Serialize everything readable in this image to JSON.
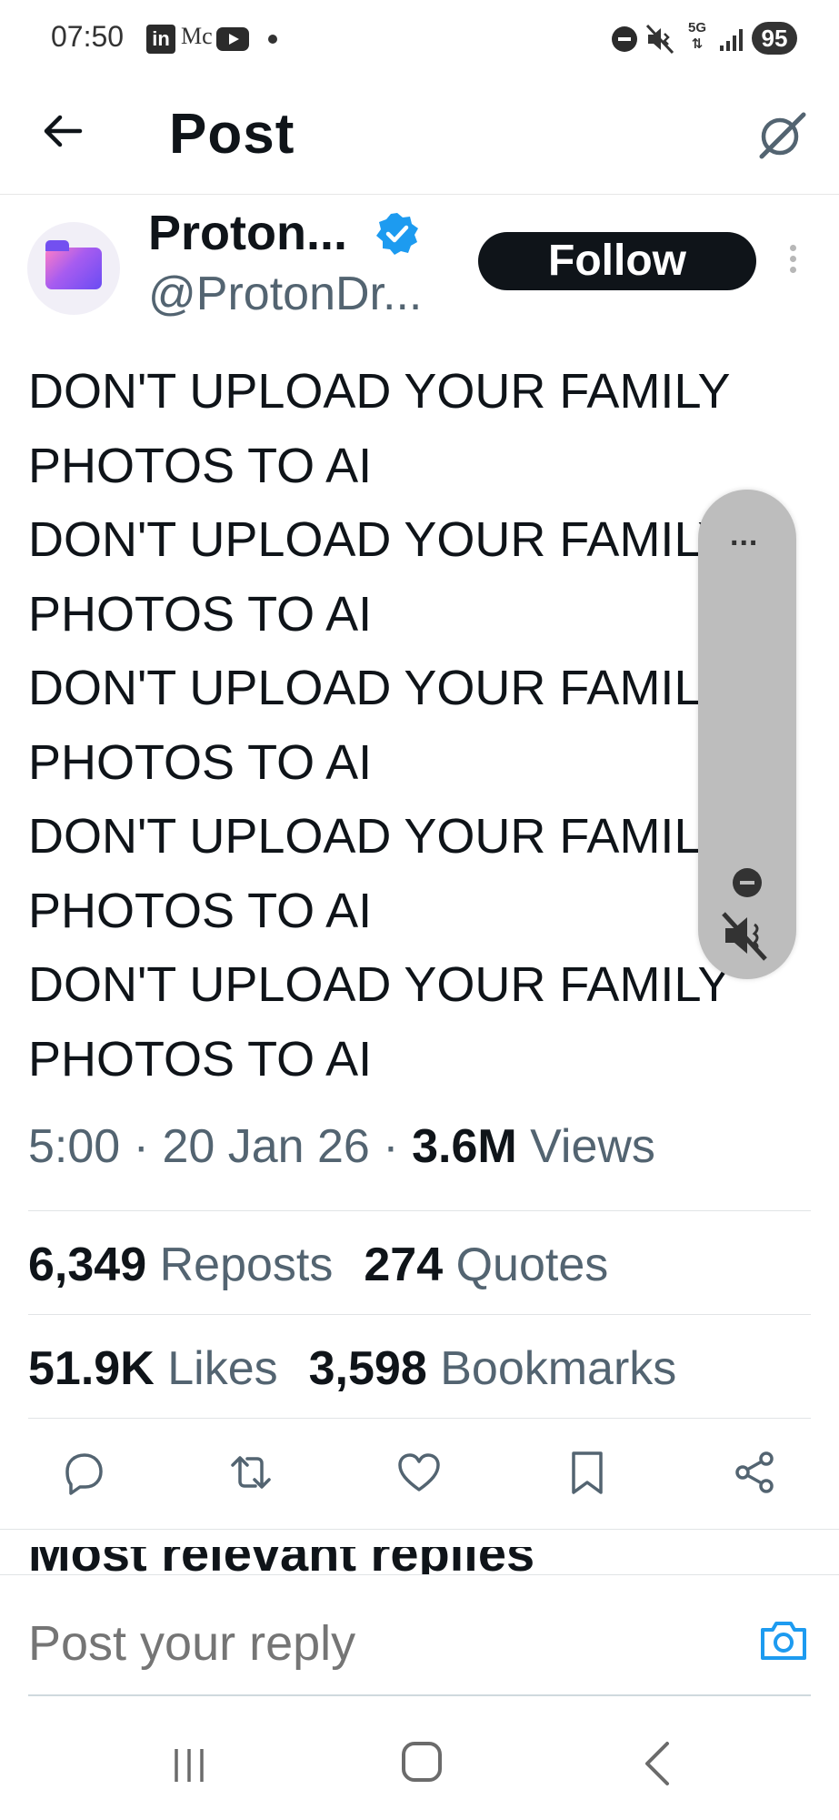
{
  "status_bar": {
    "time": "07:50",
    "linkedin_label": "in",
    "m_label": "Mc",
    "five_g": "5G",
    "battery": "95"
  },
  "header": {
    "title": "Post",
    "back_icon": "arrow-left-icon",
    "grok_icon": "grok-icon"
  },
  "post": {
    "author_name": "Proton...",
    "author_handle": "@ProtonDr...",
    "verified": true,
    "follow_label": "Follow",
    "text_lines": [
      "DON'T UPLOAD YOUR FAMILY",
      "PHOTOS TO AI",
      "DON'T UPLOAD YOUR FAMILY",
      "PHOTOS TO AI",
      "DON'T UPLOAD YOUR FAMILY",
      "PHOTOS TO AI",
      "DON'T UPLOAD YOUR FAMILY",
      "PHOTOS TO AI",
      "DON'T UPLOAD YOUR FAMILY",
      "PHOTOS TO AI"
    ],
    "time": "5:00",
    "date": "20 Jan 26",
    "views_count": "3.6M",
    "views_label": "Views",
    "reposts_count": "6,349",
    "reposts_label": "Reposts",
    "quotes_count": "274",
    "quotes_label": "Quotes",
    "likes_count": "51.9K",
    "likes_label": "Likes",
    "bookmarks_count": "3,598",
    "bookmarks_label": "Bookmarks"
  },
  "actions": [
    "reply-icon",
    "repost-icon",
    "like-icon",
    "bookmark-icon",
    "share-icon"
  ],
  "next_section_partial": "Most relevant replies",
  "reply": {
    "placeholder": "Post your reply"
  },
  "volume_panel": {
    "more_label": "..."
  },
  "colors": {
    "text_primary": "#0f1419",
    "text_secondary": "#536471",
    "verified_blue": "#1d9bf0",
    "follow_bg": "#0f1419",
    "panel_gray": "#bdbdbd"
  }
}
